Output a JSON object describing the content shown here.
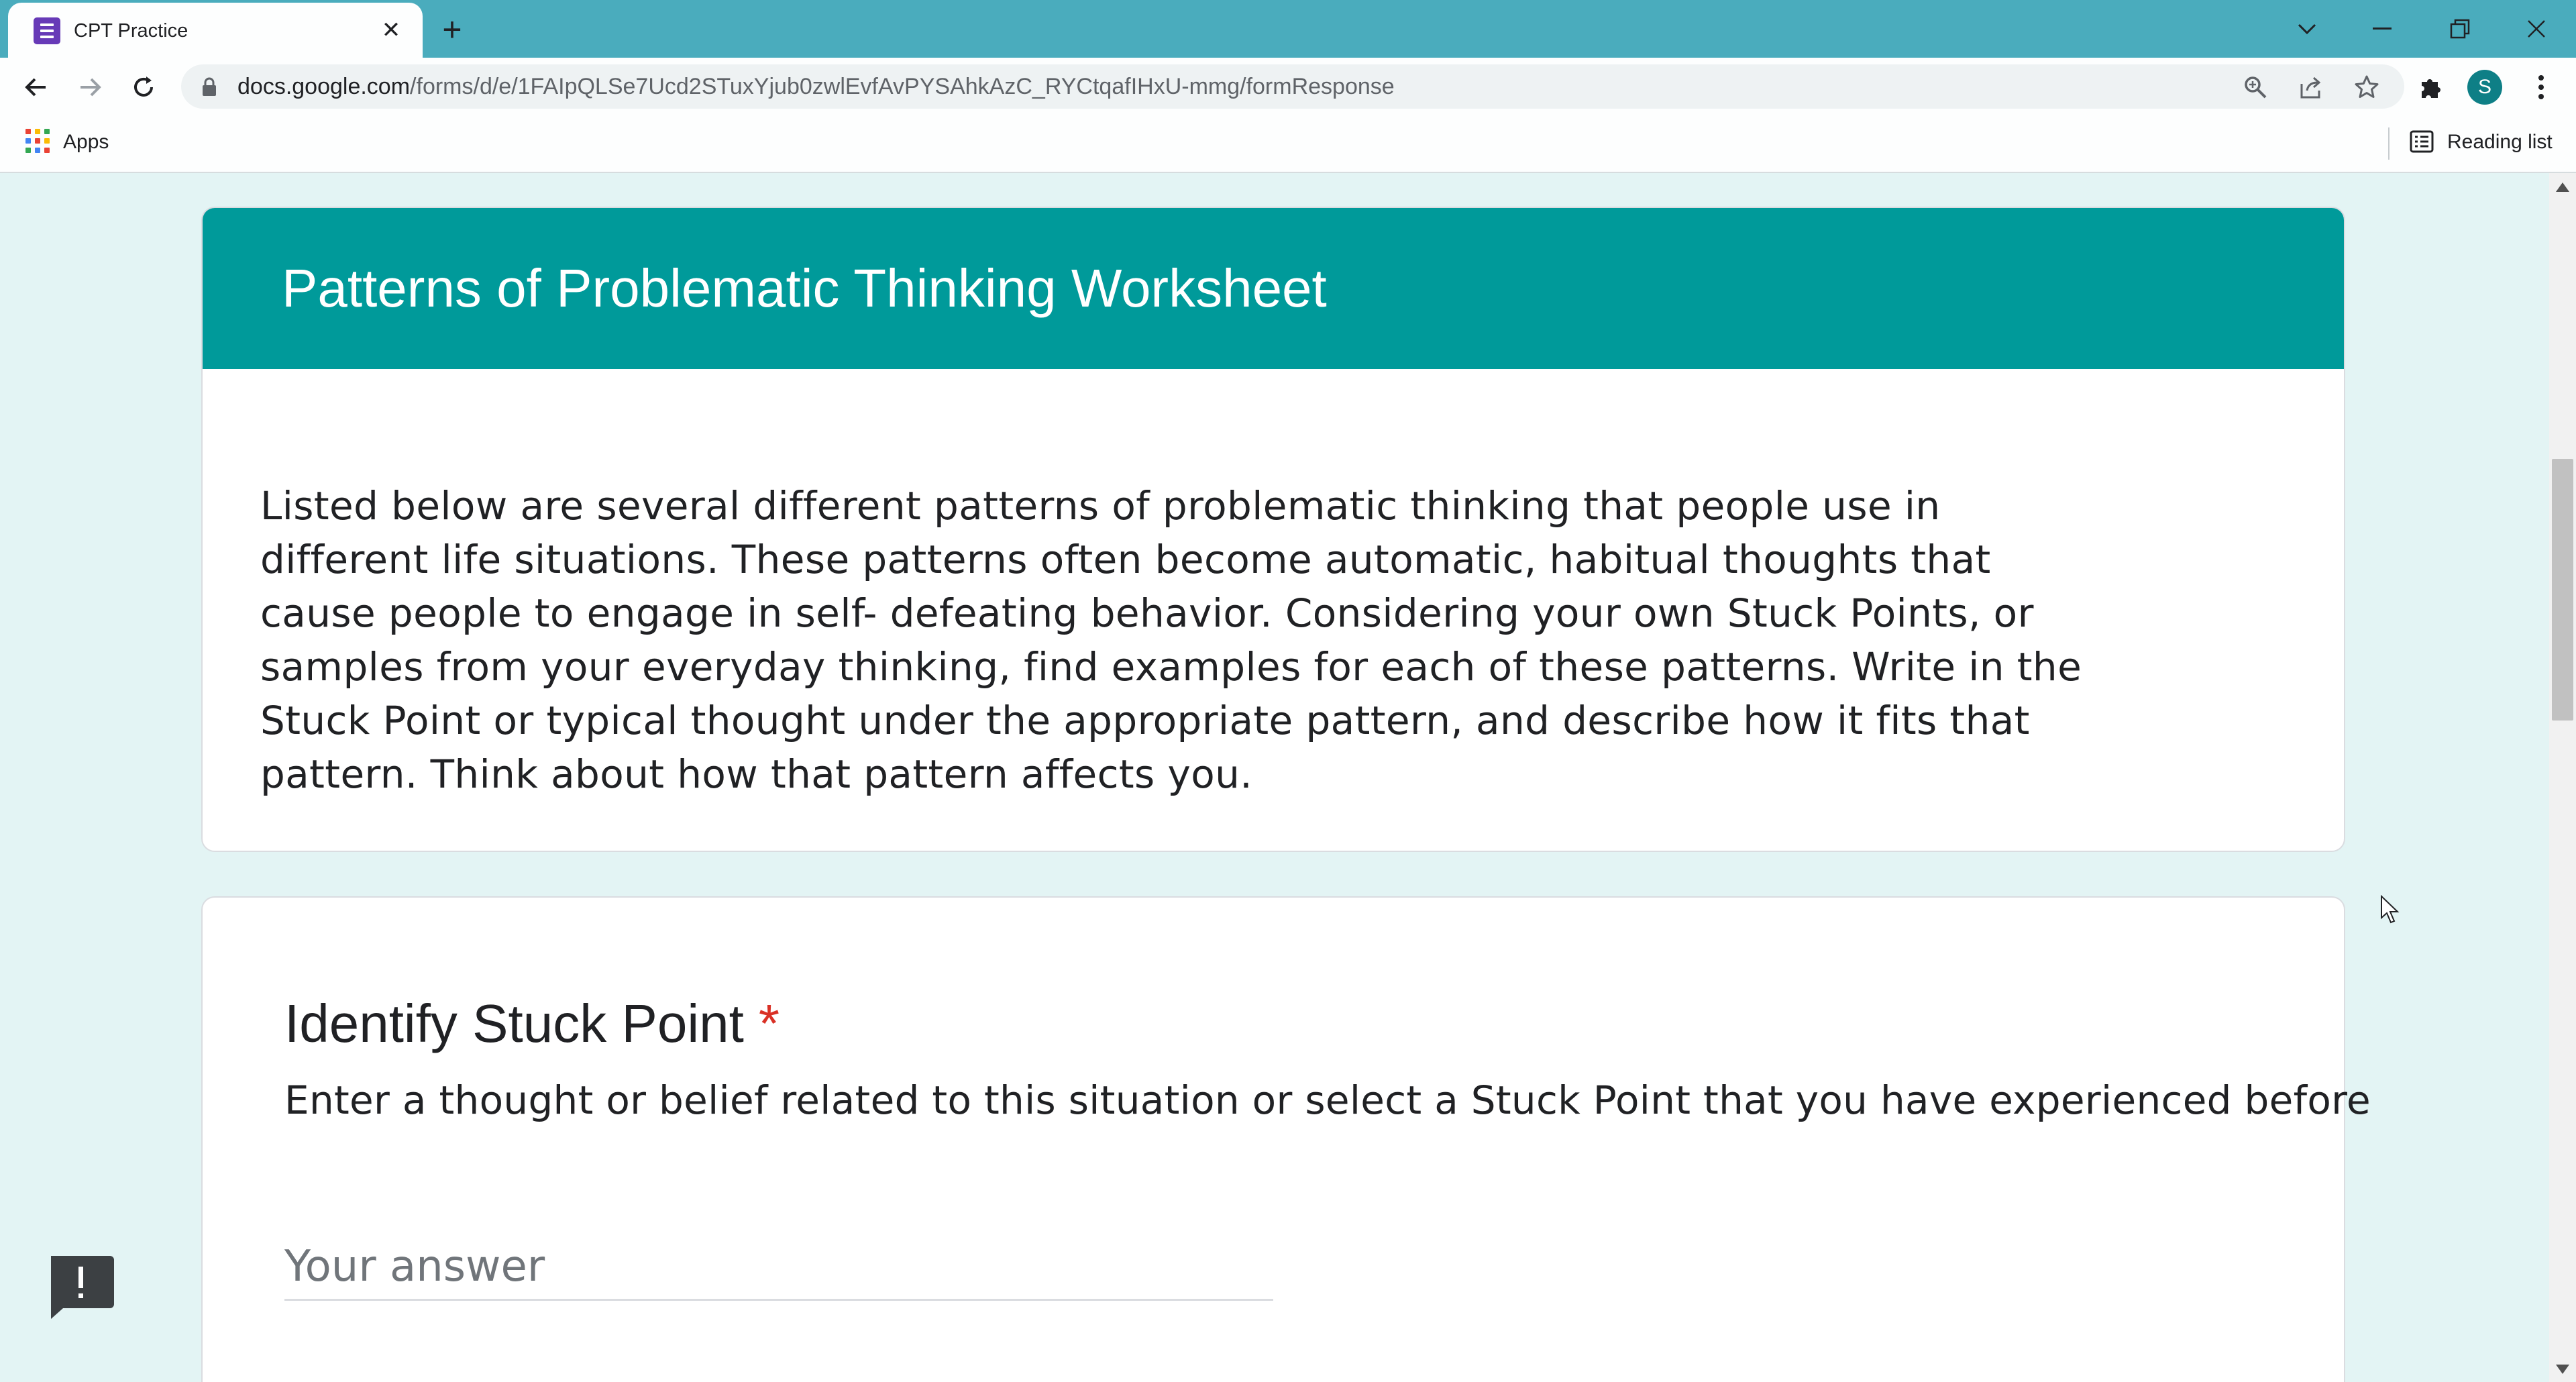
{
  "browser": {
    "tab_title": "CPT Practice",
    "url_host": "docs.google.com",
    "url_path": "/forms/d/e/1FAIpQLSe7Ucd2STuxYjub0zwlEvfAvPYSAhkAzC_RYCtqafIHxU-mmg/formResponse",
    "avatar_letter": "S",
    "bookmarks": {
      "apps_label": "Apps",
      "reading_list_label": "Reading list"
    }
  },
  "form": {
    "title": "Patterns of Problematic Thinking Worksheet",
    "description": "Listed below are several different patterns of problematic thinking that people use in different life situations. These patterns often become automatic, habitual thoughts that cause people to engage in self- defeating behavior. Considering your own Stuck Points, or samples from your everyday thinking, find examples for each of these patterns. Write in the Stuck Point or typical thought under the appropriate pattern, and describe how it fits that pattern. Think about how that pattern affects you.",
    "question": {
      "title": "Identify Stuck Point",
      "required_mark": "*",
      "help_text": "Enter a thought or belief related to this situation or select a Stuck Point that you have experienced before",
      "answer_placeholder": "Your answer",
      "answer_value": ""
    }
  },
  "colors": {
    "titlebar": "#4aacbd",
    "form_header": "#009a9a",
    "page_background": "#e3f4f4",
    "required": "#d93025",
    "forms_icon": "#673ab7"
  },
  "icons": [
    "google-forms-icon",
    "close-icon",
    "plus-icon",
    "chevron-down-icon",
    "minimize-icon",
    "restore-icon",
    "window-close-icon",
    "back-arrow-icon",
    "forward-arrow-icon",
    "reload-icon",
    "lock-icon",
    "zoom-icon",
    "share-icon",
    "star-icon",
    "puzzle-icon",
    "kebab-menu-icon",
    "apps-grid-icon",
    "reading-list-icon",
    "feedback-icon"
  ]
}
